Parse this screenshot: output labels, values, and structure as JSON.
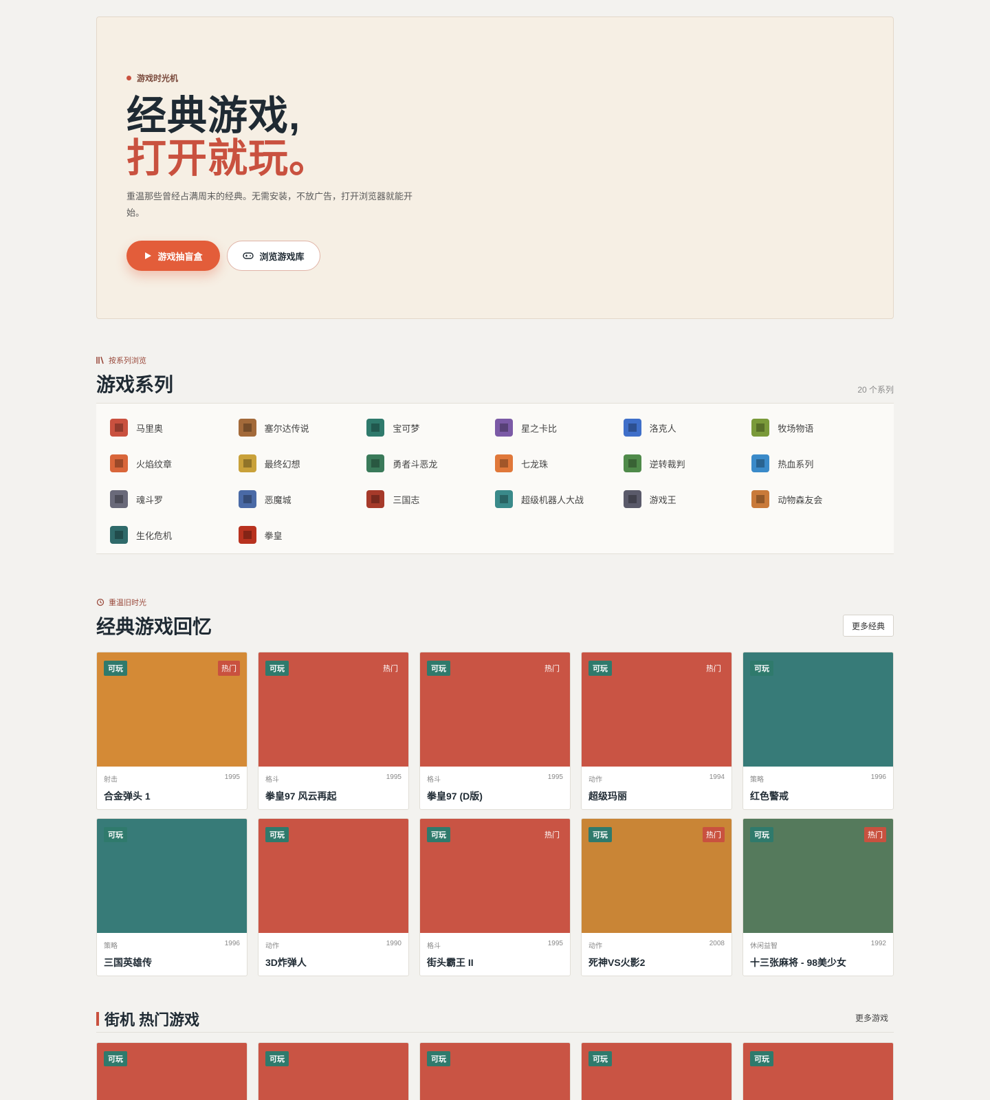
{
  "hero": {
    "eyebrow": "游戏时光机",
    "title_line1": "经典游戏,",
    "title_line2": "打开就玩。",
    "description": "重温那些曾经占满周末的经典。无需安装，不放广告，打开浏览器就能开始。",
    "primary_button": "游戏抽盲盒",
    "secondary_button": "浏览游戏库"
  },
  "series": {
    "eyebrow": "按系列浏览",
    "title": "游戏系列",
    "count": "20 个系列",
    "items": [
      {
        "label": "马里奥",
        "color": "#c9513f"
      },
      {
        "label": "塞尔达传说",
        "color": "#a36a3a"
      },
      {
        "label": "宝可梦",
        "color": "#2f7a6c"
      },
      {
        "label": "星之卡比",
        "color": "#7b5aa6"
      },
      {
        "label": "洛克人",
        "color": "#3f6fc9"
      },
      {
        "label": "牧场物语",
        "color": "#7a9a3a"
      },
      {
        "label": "火焰纹章",
        "color": "#d9663a"
      },
      {
        "label": "最终幻想",
        "color": "#c9a13a"
      },
      {
        "label": "勇者斗恶龙",
        "color": "#3a7a5a"
      },
      {
        "label": "七龙珠",
        "color": "#e0783a"
      },
      {
        "label": "逆转裁判",
        "color": "#4f8a4a"
      },
      {
        "label": "热血系列",
        "color": "#3a8ac9"
      },
      {
        "label": "魂斗罗",
        "color": "#6a6a7a"
      },
      {
        "label": "恶魔城",
        "color": "#4a6aa6"
      },
      {
        "label": "三国志",
        "color": "#a63a2a"
      },
      {
        "label": "超级机器人大战",
        "color": "#3a8a8a"
      },
      {
        "label": "游戏王",
        "color": "#5a5a6a"
      },
      {
        "label": "动物森友会",
        "color": "#c97a3a"
      },
      {
        "label": "生化危机",
        "color": "#2f6a6a"
      },
      {
        "label": "拳皇",
        "color": "#b8321f"
      }
    ]
  },
  "classics": {
    "eyebrow": "重温旧时光",
    "title": "经典游戏回忆",
    "more_button": "更多经典",
    "play_label": "可玩",
    "hot_label": "热门",
    "games": [
      {
        "title": "合金弹头 1",
        "genre": "射击",
        "year": "1995",
        "color": "#d48a36",
        "hot": true,
        "hot_solid": true
      },
      {
        "title": "拳皇97 风云再起",
        "genre": "格斗",
        "year": "1995",
        "color": "#c95444",
        "hot": true,
        "hot_solid": false
      },
      {
        "title": "拳皇97 (D版)",
        "genre": "格斗",
        "year": "1995",
        "color": "#c95444",
        "hot": true,
        "hot_solid": false
      },
      {
        "title": "超级玛丽",
        "genre": "动作",
        "year": "1994",
        "color": "#c95444",
        "hot": true,
        "hot_solid": false
      },
      {
        "title": "红色警戒",
        "genre": "策略",
        "year": "1996",
        "color": "#377b78",
        "hot": false,
        "hot_solid": false
      },
      {
        "title": "三国英雄传",
        "genre": "策略",
        "year": "1996",
        "color": "#377b78",
        "hot": false,
        "hot_solid": false
      },
      {
        "title": "3D炸弹人",
        "genre": "动作",
        "year": "1990",
        "color": "#c95444",
        "hot": false,
        "hot_solid": false
      },
      {
        "title": "街头霸王 II",
        "genre": "格斗",
        "year": "1995",
        "color": "#c95444",
        "hot": true,
        "hot_solid": false
      },
      {
        "title": "死神VS火影2",
        "genre": "动作",
        "year": "2008",
        "color": "#c98536",
        "hot": true,
        "hot_solid": true
      },
      {
        "title": "十三张麻将 - 98美少女",
        "genre": "休闲益智",
        "year": "1992",
        "color": "#557a5c",
        "hot": true,
        "hot_solid": true
      }
    ]
  },
  "arcade": {
    "title": "街机 热门游戏",
    "more_link": "更多游戏",
    "play_label": "可玩",
    "cards": [
      {
        "color": "#c95444"
      },
      {
        "color": "#c95444"
      },
      {
        "color": "#c95444"
      },
      {
        "color": "#c95444"
      },
      {
        "color": "#c95444"
      }
    ]
  }
}
